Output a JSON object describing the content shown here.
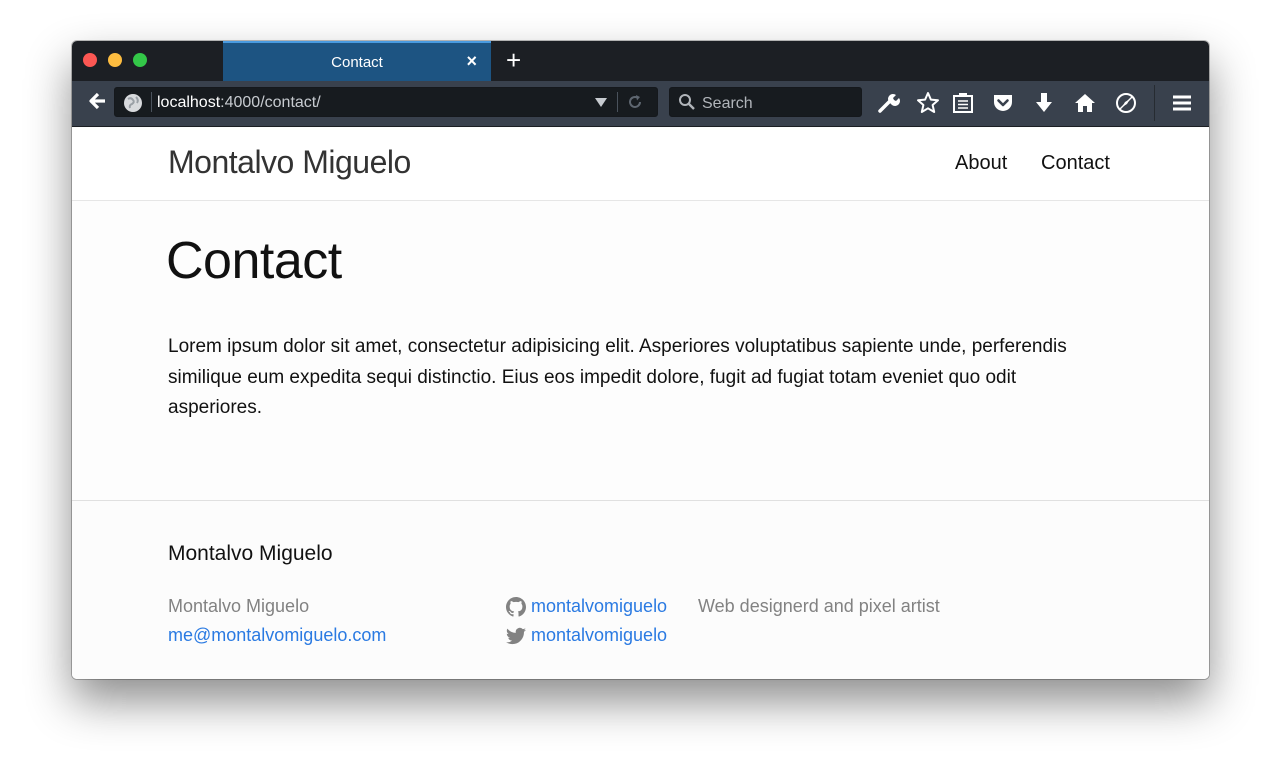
{
  "browser": {
    "tab_title": "Contact",
    "tab_close": "×",
    "new_tab": "+",
    "url_host": "localhost",
    "url_path": ":4000/contact/",
    "search_placeholder": "Search",
    "toolbar_icons": [
      "wrench-icon",
      "star-icon",
      "reader-icon",
      "pocket-icon",
      "download-icon",
      "home-icon",
      "compass-icon",
      "menu-icon"
    ]
  },
  "site": {
    "title": "Montalvo Miguelo",
    "nav": {
      "about": "About",
      "contact": "Contact"
    }
  },
  "main": {
    "heading": "Contact",
    "body": "Lorem ipsum dolor sit amet, consectetur adipisicing elit. Asperiores voluptatibus sapiente unde, perferendis similique eum expedita sequi distinctio. Eius eos impedit dolore, fugit ad fugiat totam eveniet quo odit asperiores."
  },
  "footer": {
    "heading": "Montalvo Miguelo",
    "name": "Montalvo Miguelo",
    "email": "me@montalvomiguelo.com",
    "github": "montalvomiguelo",
    "twitter": "montalvomiguelo",
    "description": "Web designerd and pixel artist"
  },
  "colors": {
    "link": "#2a7ae2",
    "muted": "#828282",
    "tab_active": "#1d5482"
  }
}
